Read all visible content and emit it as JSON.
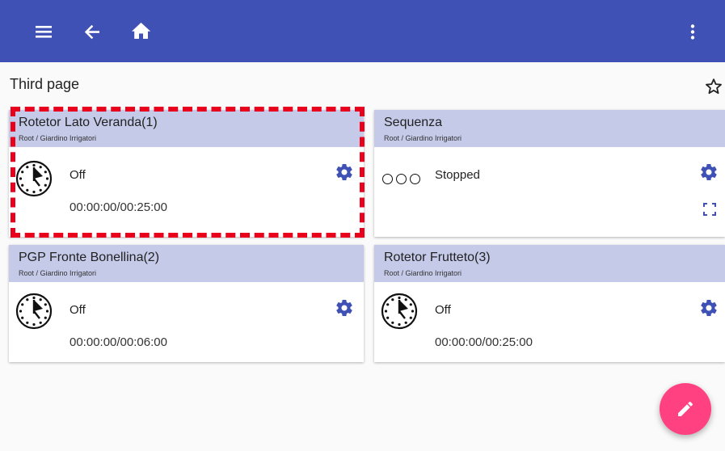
{
  "appbar": {
    "background": "#3f51b5",
    "icons": [
      "menu-icon",
      "back-arrow-icon",
      "home-icon",
      "more-vert-icon"
    ]
  },
  "page": {
    "title": "Third page",
    "favorite_icon": "star-outline-icon"
  },
  "cards": [
    {
      "title": "Rotetor Lato Veranda(1)",
      "subtitle": "Root / Giardino Irrigatori",
      "status": "Off",
      "time": "00:00:00/00:25:00",
      "icon": "timer-clock-icon",
      "highlighted": true
    },
    {
      "title": "Sequenza",
      "subtitle": "Root / Giardino Irrigatori",
      "status": "Stopped",
      "icon": "sequence-dots-icon"
    },
    {
      "title": "PGP Fronte Bonellina(2)",
      "subtitle": "Root / Giardino Irrigatori",
      "status": "Off",
      "time": "00:00:00/00:06:00",
      "icon": "timer-clock-icon"
    },
    {
      "title": "Rotetor Frutteto(3)",
      "subtitle": "Root / Giardino Irrigatori",
      "status": "Off",
      "time": "00:00:00/00:25:00",
      "icon": "timer-clock-icon"
    }
  ],
  "fab": {
    "icon": "pencil-icon",
    "color": "#ff4081"
  },
  "colors": {
    "card_header": "#c5cae9",
    "accent_gear": "#3f51b5",
    "highlight": "#e8001c"
  }
}
